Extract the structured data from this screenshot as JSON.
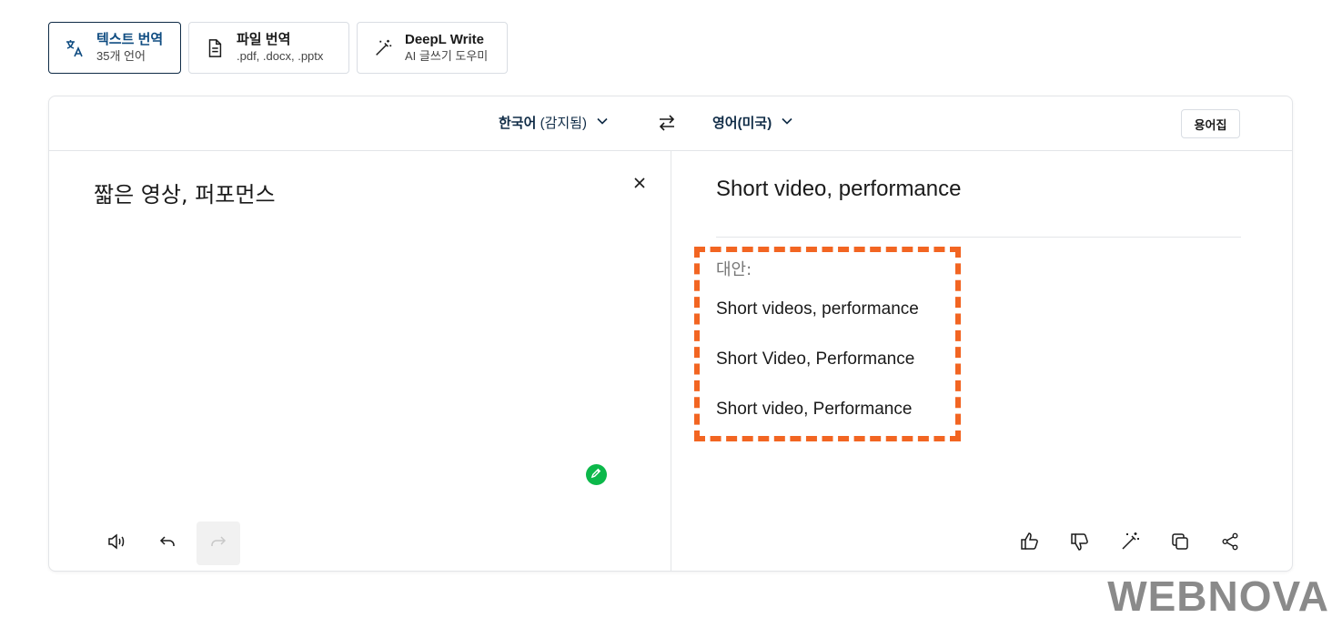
{
  "tabs": [
    {
      "title": "텍스트 번역",
      "subtitle": "35개 언어",
      "icon": "translate-icon"
    },
    {
      "title": "파일 번역",
      "subtitle": ".pdf, .docx, .pptx",
      "icon": "document-icon"
    },
    {
      "title": "DeepL Write",
      "subtitle": "AI 글쓰기 도우미",
      "icon": "magic-wand-icon"
    }
  ],
  "langbar": {
    "source_lang": "한국어",
    "source_detected": "(감지됨)",
    "target_lang": "영어(미국)",
    "glossary_label": "용어집"
  },
  "source": {
    "text": "짧은 영상, 퍼포먼스"
  },
  "target": {
    "text": "Short video, performance",
    "alternatives_label": "대안:",
    "alternatives": [
      "Short videos, performance",
      "Short Video, Performance",
      "Short video, Performance"
    ]
  },
  "colors": {
    "accent": "#0f4c81",
    "highlight_box": "#f26522",
    "grammar_dot": "#0cb84a"
  },
  "watermark": "WEBNOVA"
}
